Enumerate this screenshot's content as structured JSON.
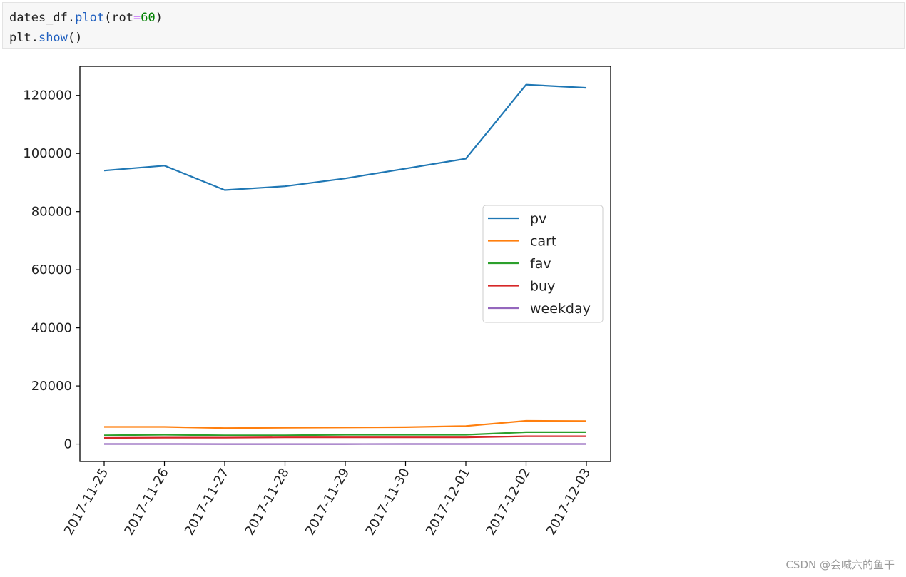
{
  "code": {
    "line1": {
      "obj": "dates_df.",
      "fn": "plot",
      "open": "(rot",
      "op": "=",
      "num": "60",
      "close": ")"
    },
    "line2": {
      "obj": "plt.",
      "fn": "show",
      "rest": "()"
    }
  },
  "watermark": "CSDN @会喊六的鱼干",
  "chart_data": {
    "type": "line",
    "x": [
      "2017-11-25",
      "2017-11-26",
      "2017-11-27",
      "2017-11-28",
      "2017-11-29",
      "2017-11-30",
      "2017-12-01",
      "2017-12-02",
      "2017-12-03"
    ],
    "xtick_rotation_deg": 60,
    "ylim": [
      -6000,
      130000
    ],
    "yticks": [
      0,
      20000,
      40000,
      60000,
      80000,
      100000,
      120000
    ],
    "grid": false,
    "legend_position": "center-right",
    "series": [
      {
        "name": "pv",
        "color": "#1f77b4",
        "values": [
          94100,
          95800,
          87400,
          88700,
          91400,
          94800,
          98200,
          123700,
          122600
        ]
      },
      {
        "name": "cart",
        "color": "#ff7f0e",
        "values": [
          5900,
          5900,
          5500,
          5600,
          5700,
          5800,
          6200,
          8000,
          7900
        ]
      },
      {
        "name": "fav",
        "color": "#2ca02c",
        "values": [
          3000,
          3200,
          3000,
          3000,
          3200,
          3200,
          3200,
          4100,
          4100
        ]
      },
      {
        "name": "buy",
        "color": "#d62728",
        "values": [
          2100,
          2200,
          2200,
          2300,
          2300,
          2300,
          2300,
          2700,
          2700
        ]
      },
      {
        "name": "weekday",
        "color": "#9467bd",
        "values": [
          5,
          6,
          0,
          1,
          2,
          3,
          4,
          5,
          6
        ]
      }
    ]
  }
}
